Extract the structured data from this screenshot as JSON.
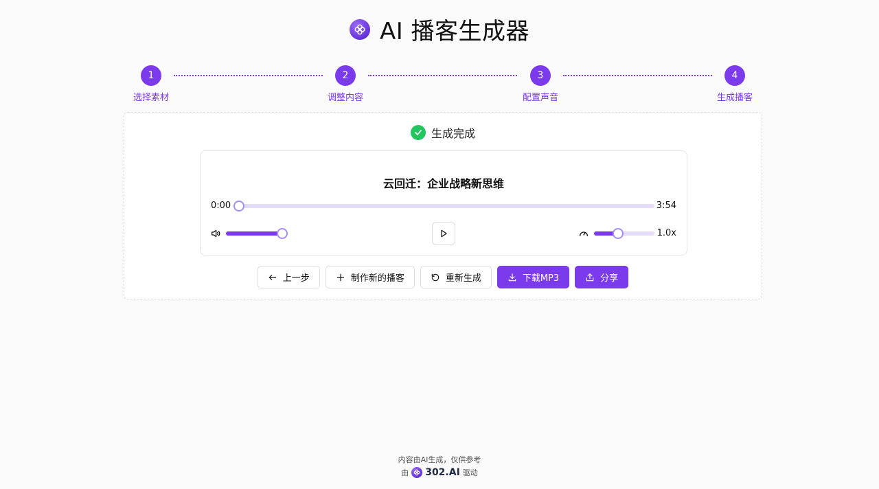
{
  "header": {
    "title": "AI 播客生成器",
    "logo_icon": "flower-logo-icon"
  },
  "stepper": {
    "steps": [
      {
        "number": "1",
        "label": "选择素材"
      },
      {
        "number": "2",
        "label": "调整内容"
      },
      {
        "number": "3",
        "label": "配置声音"
      },
      {
        "number": "4",
        "label": "生成播客"
      }
    ],
    "active_color": "#7c3aed"
  },
  "status": {
    "text": "生成完成",
    "icon": "check-circle-icon",
    "color": "#22c55e"
  },
  "player": {
    "title": "云回迁：企业战略新思维",
    "current_time": "0:00",
    "duration": "3:54",
    "progress_fraction": 0.0,
    "volume_fraction": 1.0,
    "speed_fraction": 0.4,
    "speed_label": "1.0x",
    "volume_icon": "volume-icon",
    "play_icon": "play-icon",
    "speed_icon": "speedometer-icon"
  },
  "actions": {
    "back": {
      "label": "上一步",
      "icon": "arrow-left-icon"
    },
    "new": {
      "label": "制作新的播客",
      "icon": "plus-icon"
    },
    "regenerate": {
      "label": "重新生成",
      "icon": "refresh-icon"
    },
    "download": {
      "label": "下载MP3",
      "icon": "download-icon"
    },
    "share": {
      "label": "分享",
      "icon": "share-icon"
    }
  },
  "footer": {
    "disclaimer": "内容由AI生成，仅供参考",
    "powered_prefix": "由",
    "brand": "302.AI",
    "powered_suffix": "驱动"
  },
  "colors": {
    "accent": "#7c3aed",
    "track": "#e5dcf8",
    "success": "#22c55e"
  }
}
